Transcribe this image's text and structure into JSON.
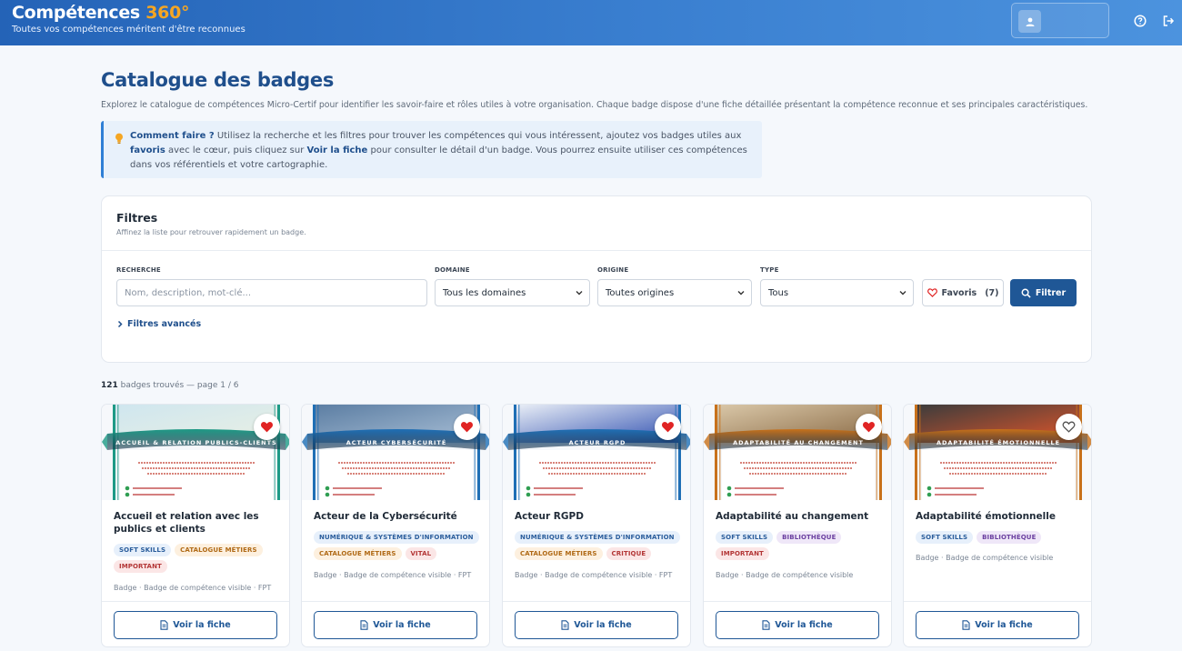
{
  "header": {
    "brand_main": "Compétences",
    "brand_accent": "360°",
    "tagline": "Toutes vos compétences méritent d'être reconnues",
    "icons": [
      "user-icon",
      "help-icon",
      "logout-icon"
    ]
  },
  "page": {
    "title": "Catalogue des badges",
    "description": "Explorez le catalogue de compétences Micro-Certif pour identifier les savoir-faire et rôles utiles à votre organisation. Chaque badge dispose d'une fiche détaillée présentant la compétence reconnue et ses principales caractéristiques."
  },
  "howto": {
    "lead": "Comment faire ?",
    "t1": " Utilisez la recherche et les filtres pour trouver les compétences qui vous intéressent, ajoutez vos badges utiles aux ",
    "favorites": "favoris",
    "t2": " avec le cœur, puis cliquez sur ",
    "view_sheet": "Voir la fiche",
    "t3": " pour consulter le détail d'un badge. Vous pourrez ensuite utiliser ces compétences dans vos référentiels et votre cartographie."
  },
  "filters": {
    "title": "Filtres",
    "subtitle": "Affinez la liste pour retrouver rapidement un badge.",
    "search_label": "RECHERCHE",
    "search_placeholder": "Nom, description, mot-clé...",
    "domain_label": "DOMAINE",
    "domain_value": "Tous les domaines",
    "origin_label": "ORIGINE",
    "origin_value": "Toutes origines",
    "type_label": "TYPE",
    "type_value": "Tous",
    "favorites_button": "Favoris",
    "favorites_count": "(7)",
    "filter_button": "Filtrer",
    "advanced": "Filtres avancés"
  },
  "results": {
    "count": "121",
    "text": " badges trouvés — page 1 / 6"
  },
  "cards": [
    {
      "title": "Accueil et relation avec les publics et clients",
      "ribbon": "ACCUEIL & RELATION PUBLICS-CLIENTS",
      "favorite": true,
      "tags": [
        {
          "label": "SOFT SKILLS",
          "color": "blue"
        },
        {
          "label": "CATALOGUE MÉTIERS",
          "color": "orange"
        },
        {
          "label": "IMPORTANT",
          "color": "red"
        }
      ],
      "meta": "Badge · Badge de compétence visible · FPT",
      "action": "Voir la fiche",
      "theme": "#1e9a86"
    },
    {
      "title": "Acteur de la Cybersécurité",
      "ribbon": "ACTEUR CYBERSÉCURITÉ",
      "favorite": true,
      "tags": [
        {
          "label": "NUMÉRIQUE & SYSTÈMES D'INFORMATION",
          "color": "blue"
        },
        {
          "label": "CATALOGUE MÉTIERS",
          "color": "orange"
        },
        {
          "label": "VITAL",
          "color": "red"
        }
      ],
      "meta": "Badge · Badge de compétence visible · FPT",
      "action": "Voir la fiche",
      "theme": "#1f6fb5"
    },
    {
      "title": "Acteur RGPD",
      "ribbon": "ACTEUR RGPD",
      "favorite": true,
      "tags": [
        {
          "label": "NUMÉRIQUE & SYSTÈMES D'INFORMATION",
          "color": "blue"
        },
        {
          "label": "CATALOGUE MÉTIERS",
          "color": "orange"
        },
        {
          "label": "CRITIQUE",
          "color": "red"
        }
      ],
      "meta": "Badge · Badge de compétence visible · FPT",
      "action": "Voir la fiche",
      "theme": "#1f6fb5"
    },
    {
      "title": "Adaptabilité au changement",
      "ribbon": "ADAPTABILITÉ AU CHANGEMENT",
      "favorite": true,
      "tags": [
        {
          "label": "SOFT SKILLS",
          "color": "blue"
        },
        {
          "label": "BIBLIOTHÈQUE",
          "color": "purple"
        },
        {
          "label": "IMPORTANT",
          "color": "red"
        }
      ],
      "meta": "Badge · Badge de compétence visible",
      "action": "Voir la fiche",
      "theme": "#c8711a"
    },
    {
      "title": "Adaptabilité émotionnelle",
      "ribbon": "ADAPTABILITÉ ÉMOTIONNELLE",
      "favorite": false,
      "tags": [
        {
          "label": "SOFT SKILLS",
          "color": "blue"
        },
        {
          "label": "BIBLIOTHÈQUE",
          "color": "purple"
        }
      ],
      "meta": "Badge · Badge de compétence visible",
      "action": "Voir la fiche",
      "theme": "#c8711a"
    }
  ],
  "colors": {
    "header_blue": "#2463b7",
    "brand_orange": "#f5a623",
    "primary": "#1f5796",
    "favorite_red": "#e02424"
  }
}
